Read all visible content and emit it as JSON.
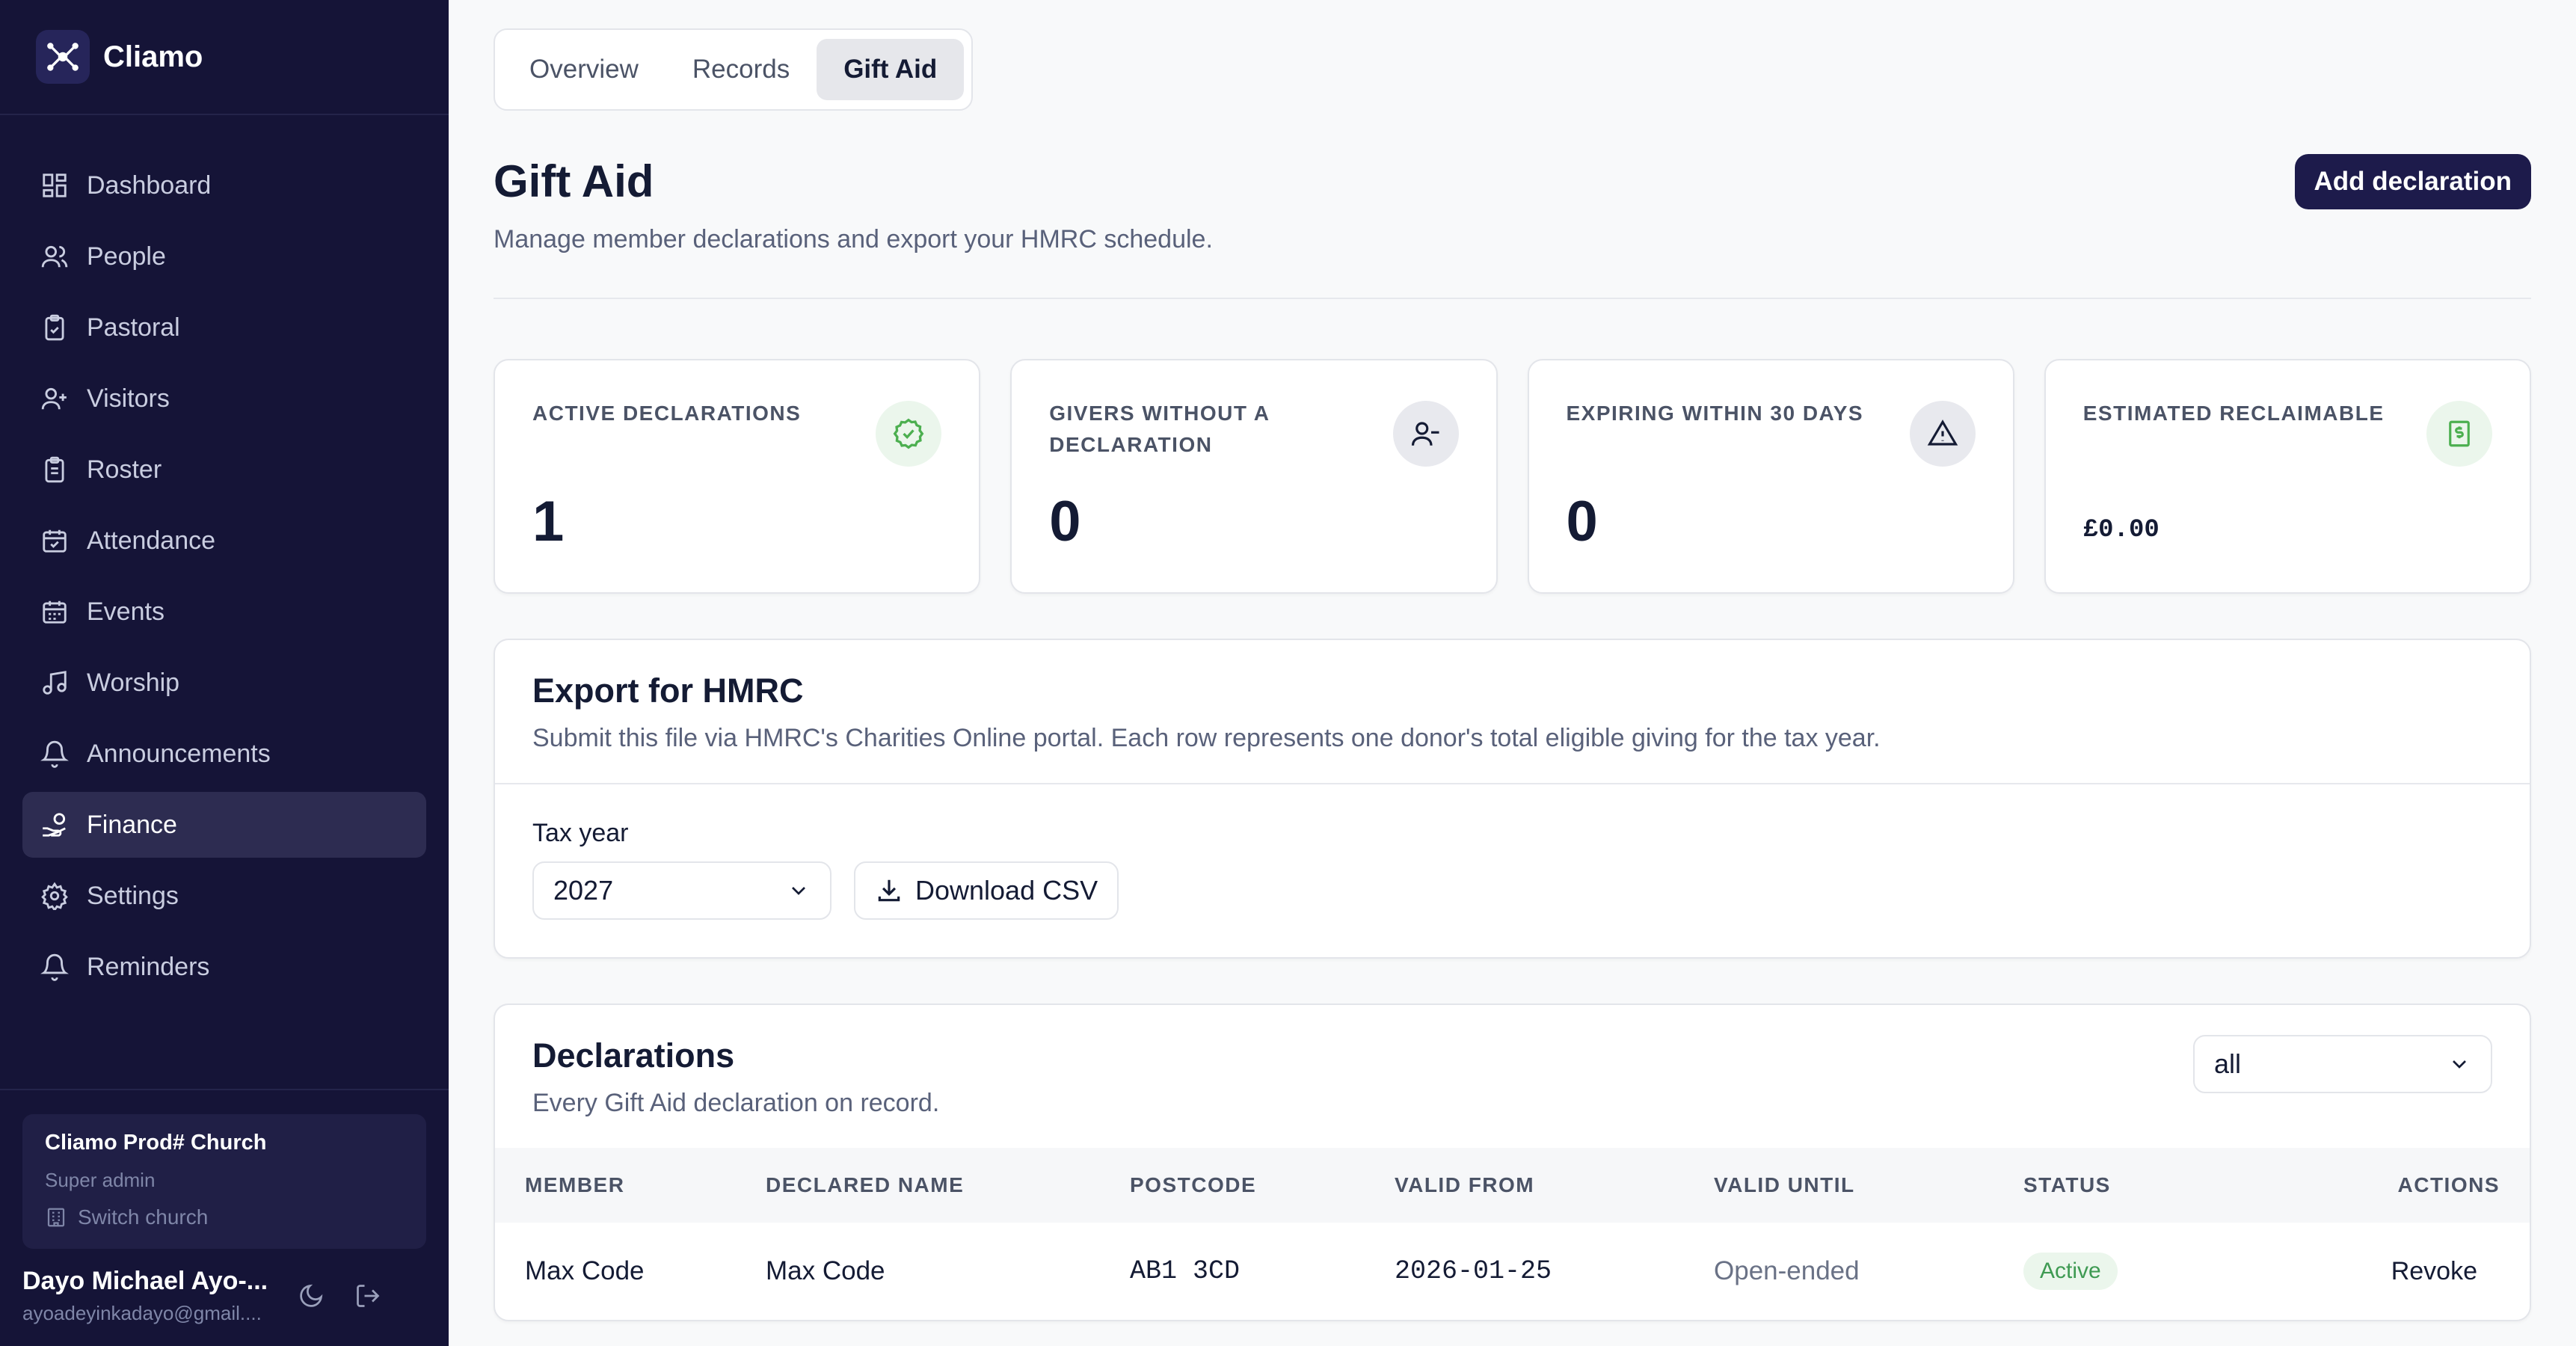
{
  "app": {
    "name": "Cliamo"
  },
  "sidebar": {
    "items": [
      {
        "label": "Dashboard",
        "icon": "dashboard-icon"
      },
      {
        "label": "People",
        "icon": "people-icon"
      },
      {
        "label": "Pastoral",
        "icon": "clipboard-icon"
      },
      {
        "label": "Visitors",
        "icon": "user-plus-icon"
      },
      {
        "label": "Roster",
        "icon": "clipboard-list-icon"
      },
      {
        "label": "Attendance",
        "icon": "calendar-check-icon"
      },
      {
        "label": "Events",
        "icon": "calendar-icon"
      },
      {
        "label": "Worship",
        "icon": "music-icon"
      },
      {
        "label": "Announcements",
        "icon": "bell-icon"
      },
      {
        "label": "Finance",
        "icon": "hand-coins-icon",
        "active": true
      },
      {
        "label": "Settings",
        "icon": "gear-icon"
      },
      {
        "label": "Reminders",
        "icon": "bell-icon"
      }
    ],
    "church": {
      "name": "Cliamo Prod# Church",
      "role": "Super admin",
      "switch_label": "Switch church"
    },
    "user": {
      "name": "Dayo Michael Ayo-...",
      "email": "ayoadeyinkadayo@gmail...."
    }
  },
  "tabs": [
    {
      "label": "Overview"
    },
    {
      "label": "Records"
    },
    {
      "label": "Gift Aid",
      "active": true
    }
  ],
  "header": {
    "title": "Gift Aid",
    "subtitle": "Manage member declarations and export your HMRC schedule.",
    "add_button": "Add declaration"
  },
  "stats": [
    {
      "label": "ACTIVE DECLARATIONS",
      "value": "1",
      "icon": "check-circle-icon",
      "icon_color": "#4caf50",
      "icon_bg": "#ebf6ec"
    },
    {
      "label": "GIVERS WITHOUT A DECLARATION",
      "value": "0",
      "icon": "user-minus-icon",
      "icon_color": "#141b34",
      "icon_bg": "#e8e9ee"
    },
    {
      "label": "EXPIRING WITHIN 30 DAYS",
      "value": "0",
      "icon": "warning-icon",
      "icon_color": "#141b34",
      "icon_bg": "#e8e9ee"
    },
    {
      "label": "ESTIMATED RECLAIMABLE",
      "value": "£0.00",
      "icon": "currency-note-icon",
      "icon_color": "#4caf50",
      "icon_bg": "#ebf6ec"
    }
  ],
  "export": {
    "title": "Export for HMRC",
    "description": "Submit this file via HMRC's Charities Online portal. Each row represents one donor's total eligible giving for the tax year.",
    "tax_year_label": "Tax year",
    "tax_year_value": "2027",
    "download_label": "Download CSV"
  },
  "declarations": {
    "title": "Declarations",
    "description": "Every Gift Aid declaration on record.",
    "filter_value": "all",
    "columns": [
      "MEMBER",
      "DECLARED NAME",
      "POSTCODE",
      "VALID FROM",
      "VALID UNTIL",
      "STATUS",
      "ACTIONS"
    ],
    "rows": [
      {
        "member": "Max Code",
        "declared_name": "Max Code",
        "postcode": "AB1 3CD",
        "valid_from": "2026-01-25",
        "valid_until": "Open-ended",
        "status": "Active",
        "action": "Revoke"
      }
    ]
  },
  "colors": {
    "sidebar_bg": "#151437",
    "accent": "#1d1b4b",
    "success": "#3e9a52"
  }
}
